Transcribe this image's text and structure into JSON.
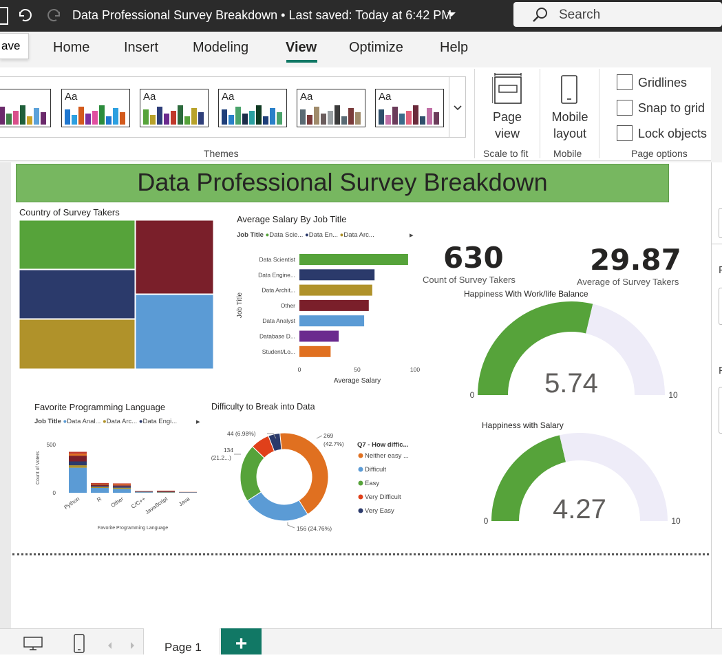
{
  "titlebar": {
    "title": "Data Professional Survey Breakdown • Last saved: Today at 6:42 PM",
    "search_placeholder": "Search"
  },
  "save_tooltip": "ave",
  "menu": {
    "items": [
      "Home",
      "Insert",
      "Modeling",
      "View",
      "Optimize",
      "Help"
    ],
    "active": "View"
  },
  "ribbon": {
    "themes_label": "Themes",
    "theme_swatches": [
      {
        "colors": [
          "#c9a227",
          "#5ba1d9",
          "#6b2a6b",
          "#3f7f47",
          "#d94f8a",
          "#1f5f3a"
        ]
      },
      {
        "colors": [
          "#1f77d0",
          "#2da0e0",
          "#d35a1c",
          "#7b2f9e",
          "#e04fa0",
          "#2c8c3c"
        ]
      },
      {
        "colors": [
          "#56a33a",
          "#b8a22a",
          "#2f3f7a",
          "#6b2a8e",
          "#c0392b",
          "#2d6b3d"
        ]
      },
      {
        "colors": [
          "#1f3f7a",
          "#2a80c9",
          "#4aa36b",
          "#1c2d4a",
          "#2aa0a0",
          "#0f3a22"
        ]
      },
      {
        "colors": [
          "#5a6b74",
          "#7a3b3b",
          "#a08b6b",
          "#6b5d5d",
          "#9aa0a3",
          "#3b3b3b"
        ]
      },
      {
        "colors": [
          "#2f4f6b",
          "#c06fa6",
          "#6b3b5a",
          "#3a6b8a",
          "#e0607a",
          "#6b2a3b"
        ]
      }
    ],
    "page_view_label": "Page view",
    "page_view_chevron": "⌄",
    "scale_to_fit_label": "Scale to fit",
    "mobile_layout_label": "Mobile layout",
    "mobile_label": "Mobile",
    "page_options_label": "Page options",
    "checkboxes": [
      {
        "label": "Gridlines",
        "checked": false
      },
      {
        "label": "Snap to grid",
        "checked": false
      },
      {
        "label": "Lock objects",
        "checked": false
      }
    ]
  },
  "report": {
    "title": "Data Professional Survey Breakdown",
    "treemap": {
      "title": "Country of Survey Takers",
      "colors": [
        "#56a33a",
        "#7a1f2a",
        "#2b3a6b",
        "#5b9bd5",
        "#b0922a"
      ]
    },
    "salary_chart": {
      "title": "Average Salary By Job Title",
      "legend_title": "Job Title",
      "legend_items": [
        {
          "label": "Data Scie...",
          "color": "#56a33a"
        },
        {
          "label": "Data En...",
          "color": "#2b3a6b"
        },
        {
          "label": "Data Arc...",
          "color": "#b0922a"
        }
      ],
      "legend_more": "▸",
      "y_title": "Job Title",
      "x_title": "Average Salary",
      "tick_labels": [
        "0",
        "50",
        "100"
      ]
    },
    "kpi_count": {
      "value": "630",
      "label": "Count of Survey Takers"
    },
    "kpi_avg": {
      "value": "29.87",
      "label": "Average of Survey Takers"
    },
    "gauge_worklife": {
      "title": "Happiness With Work/life Balance",
      "value_label": "5.74",
      "min_label": "0",
      "max_label": "10"
    },
    "gauge_salary": {
      "title": "Happiness with Salary",
      "value_label": "4.27",
      "min_label": "0",
      "max_label": "10"
    },
    "lang_chart": {
      "title": "Favorite Programming Language",
      "legend_title": "Job Title",
      "legend_items": [
        {
          "label": "Data Anal...",
          "color": "#5b9bd5"
        },
        {
          "label": "Data Arc...",
          "color": "#b0922a"
        },
        {
          "label": "Data Engi...",
          "color": "#2b3a6b"
        }
      ],
      "legend_more": "▸",
      "y_title": "Count of Voters",
      "x_title": "Favorite Programming Language",
      "y_ticks": [
        "500",
        "0"
      ]
    },
    "donut": {
      "title": "Difficulty to Break into Data",
      "legend_title": "Q7 - How diffic...",
      "labels": {
        "neither": [
          "269",
          "(42.7%)"
        ],
        "difficult": [
          "156 (24.76%)"
        ],
        "easy": [
          "134",
          "(21.2...)"
        ],
        "very_difficult": [
          "44 (6.98%)"
        ]
      }
    }
  },
  "chart_data": [
    {
      "type": "bar",
      "title": "Average Salary By Job Title",
      "xlabel": "Average Salary",
      "ylabel": "Job Title",
      "orientation": "horizontal",
      "categories": [
        "Data Scientist",
        "Data Engine...",
        "Data Archit...",
        "Other",
        "Data Analyst",
        "Database D...",
        "Student/Lo..."
      ],
      "values": [
        94,
        65,
        63,
        60,
        56,
        34,
        27
      ],
      "colors": [
        "#56a33a",
        "#2b3a6b",
        "#b0922a",
        "#7a1f2a",
        "#5b9bd5",
        "#6b2a8e",
        "#e07020"
      ],
      "xlim": [
        0,
        100
      ]
    },
    {
      "type": "bar",
      "stacked": true,
      "title": "Favorite Programming Language",
      "xlabel": "Favorite Programming Language",
      "ylabel": "Count of Voters",
      "categories": [
        "Python",
        "R",
        "Other",
        "C/C++",
        "JavaScript",
        "Java"
      ],
      "ylim": [
        0,
        500
      ],
      "segments": [
        {
          "color": "#5b9bd5",
          "values": [
            260,
            50,
            40,
            6,
            4,
            3
          ]
        },
        {
          "color": "#b0922a",
          "values": [
            25,
            10,
            12,
            2,
            3,
            1
          ]
        },
        {
          "color": "#2b3a6b",
          "values": [
            40,
            10,
            15,
            4,
            3,
            2
          ]
        },
        {
          "color": "#7a1f2a",
          "values": [
            60,
            15,
            10,
            3,
            5,
            1
          ]
        },
        {
          "color": "#e07020",
          "values": [
            20,
            8,
            10,
            2,
            3,
            1
          ]
        },
        {
          "color": "#c0392b",
          "values": [
            20,
            8,
            10,
            2,
            4,
            1
          ]
        }
      ]
    },
    {
      "type": "pie",
      "donut": true,
      "title": "Difficulty to Break into Data",
      "legend_title": "Q7 - How diffic...",
      "slices": [
        {
          "label": "Neither easy ...",
          "value": 269,
          "color": "#e07020"
        },
        {
          "label": "Difficult",
          "value": 156,
          "color": "#5b9bd5"
        },
        {
          "label": "Easy",
          "value": 134,
          "color": "#56a33a"
        },
        {
          "label": "Very Difficult",
          "value": 44,
          "color": "#e0401a"
        },
        {
          "label": "Very Easy",
          "value": 27,
          "color": "#2b3a6b"
        }
      ]
    },
    {
      "type": "gauge",
      "title": "Happiness With Work/life Balance",
      "value": 5.74,
      "min": 0,
      "max": 10,
      "colors": {
        "fill": "#56a33a",
        "track": "#eeecf8"
      }
    },
    {
      "type": "gauge",
      "title": "Happiness with Salary",
      "value": 4.27,
      "min": 0,
      "max": 10,
      "colors": {
        "fill": "#56a33a",
        "track": "#eeecf8"
      }
    }
  ],
  "bottom": {
    "page_tab": "Page 1",
    "add_page": "+"
  }
}
